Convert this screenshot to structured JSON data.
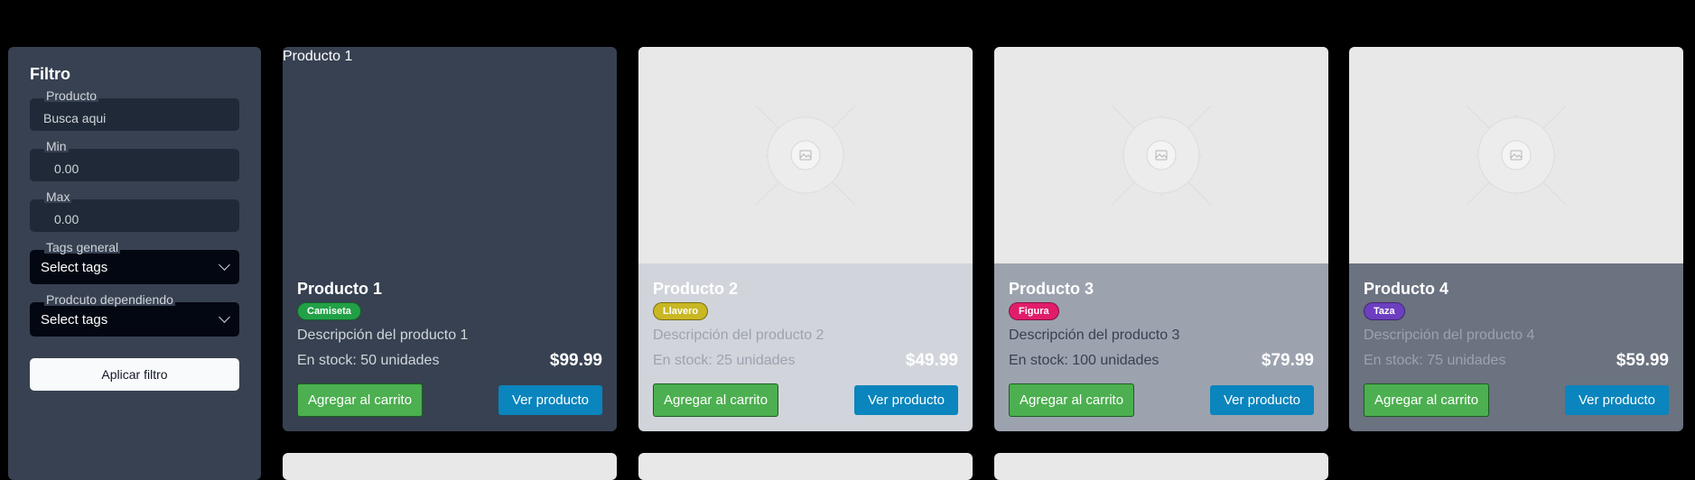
{
  "filter": {
    "title": "Filtro",
    "product_label": "Producto",
    "product_placeholder": "Busca aqui",
    "min_label": "Min",
    "min_value": "0.00",
    "max_label": "Max",
    "max_value": "0.00",
    "tags_general_label": "Tags general",
    "tags_general_value": "Select tags",
    "dependent_label": "Prodcuto dependiendo",
    "dependent_value": "Select tags",
    "apply_label": "Aplicar filtro"
  },
  "products": [
    {
      "name": "Producto 1",
      "image_alt": "Producto 1",
      "tag": "Camiseta",
      "tag_color": "#22a046",
      "description": "Descripción del producto 1",
      "stock": "En stock: 50 unidades",
      "price": "$99.99",
      "bg": "#374151",
      "text": "#d1d5db"
    },
    {
      "name": "Producto 2",
      "image_alt": "",
      "tag": "Llavero",
      "tag_color": "#c9b723",
      "description": "Descripción del producto 2",
      "stock": "En stock: 25 unidades",
      "price": "$49.99",
      "bg": "#d1d5db",
      "text": "#9ca3af"
    },
    {
      "name": "Producto 3",
      "image_alt": "",
      "tag": "Figura",
      "tag_color": "#e11d6a",
      "description": "Descripción del producto 3",
      "stock": "En stock: 100 unidades",
      "price": "$79.99",
      "bg": "#9ca3af",
      "text": "#374151"
    },
    {
      "name": "Producto 4",
      "image_alt": "",
      "tag": "Taza",
      "tag_color": "#6d3fc0",
      "description": "Descripción del producto 4",
      "stock": "En stock: 75 unidades",
      "price": "$59.99",
      "bg": "#6b7280",
      "text": "#9ca3af"
    }
  ],
  "buttons": {
    "add_to_cart": "Agregar al carrito",
    "view_product": "Ver producto"
  },
  "icons": {
    "placeholder": "image-placeholder-icon",
    "chevron": "chevron-down-icon"
  }
}
